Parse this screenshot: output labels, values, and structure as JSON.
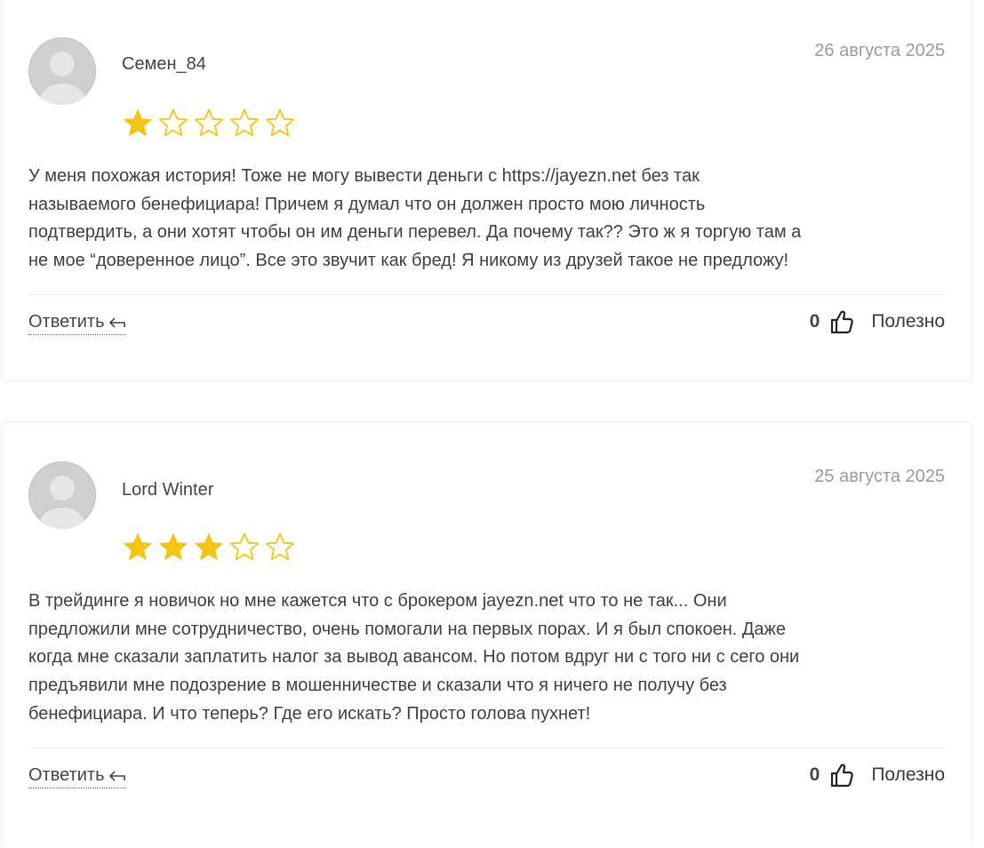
{
  "colors": {
    "star_filled": "#f2c414",
    "star_empty_stroke": "#f2c414",
    "text": "#3f3f3f",
    "date": "#9a9a9a"
  },
  "icons": {
    "avatar": "user-placeholder-icon",
    "reply": "reply-arrow-icon",
    "like": "thumbs-up-icon",
    "star": "star-icon"
  },
  "reviews": [
    {
      "author": "Семен_84",
      "date": "26 августа 2025",
      "rating": 1,
      "max_rating": 5,
      "lines": [
        "У меня похожая история! Тоже не могу вывести деньги с https://jayezn.net без так",
        "называемого бенефициара! Причем я думал что он должен просто мою личность",
        "подтвердить, а они хотят чтобы он им деньги перевел. Да почему так?? Это ж я торгую там а",
        "не мое “доверенное лицо”. Все это звучит как бред! Я никому из друзей такое не предложу!"
      ],
      "reply_label": "Ответить",
      "likes": "0",
      "useful_label": "Полезно"
    },
    {
      "author": "Lord Winter",
      "date": "25 августа 2025",
      "rating": 3,
      "max_rating": 5,
      "lines": [
        "В трейдинге я новичок но мне кажется что с брокером jayezn.net что то не так... Они",
        "предложили мне сотрудничество, очень помогали на первых порах. И я был спокоен. Даже",
        "когда мне сказали заплатить налог за вывод авансом. Но потом вдруг ни с того ни с сего они",
        "предъявили мне подозрение в мошенничестве и сказали что я ничего не получу без",
        "бенефициара. И что теперь? Где его искать? Просто голова пухнет!"
      ],
      "reply_label": "Ответить",
      "likes": "0",
      "useful_label": "Полезно"
    }
  ]
}
